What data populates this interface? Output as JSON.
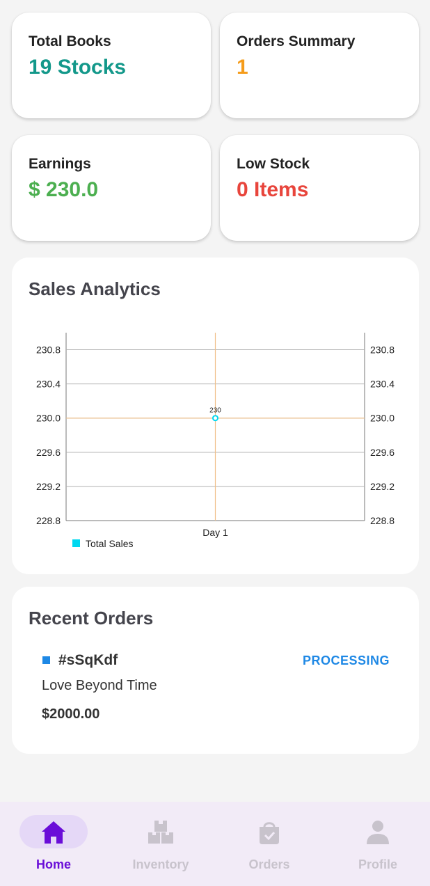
{
  "stats": [
    {
      "label": "Total Books",
      "value": "19 Stocks",
      "color": "#13988a"
    },
    {
      "label": "Orders Summary",
      "value": "1",
      "color": "#f59c1a"
    },
    {
      "label": "Earnings",
      "value": "$ 230.0",
      "color": "#4caf50"
    },
    {
      "label": "Low Stock",
      "value": "0 Items",
      "color": "#e8453c"
    }
  ],
  "analytics": {
    "title": "Sales Analytics"
  },
  "chart_data": {
    "type": "line",
    "categories": [
      "Day 1"
    ],
    "series": [
      {
        "name": "Total Sales",
        "values": [
          230
        ],
        "color": "#00d8f0"
      }
    ],
    "ylim": [
      228.8,
      231.0
    ],
    "yticks": [
      "228.8",
      "229.2",
      "229.6",
      "230.0",
      "230.4",
      "230.8"
    ],
    "data_labels": [
      "230"
    ],
    "legend_position": "bottom-left",
    "grid": true,
    "right_axis": true,
    "highlight_color": "#f0c08a"
  },
  "recent_orders": {
    "title": "Recent Orders",
    "orders": [
      {
        "id": "#sSqKdf",
        "status": "PROCESSING",
        "title": "Love Beyond Time",
        "price": "$2000.00"
      }
    ]
  },
  "nav": {
    "items": [
      {
        "label": "Home",
        "icon": "home-icon",
        "active": true
      },
      {
        "label": "Inventory",
        "icon": "inventory-icon",
        "active": false
      },
      {
        "label": "Orders",
        "icon": "orders-bag-icon",
        "active": false
      },
      {
        "label": "Profile",
        "icon": "profile-icon",
        "active": false
      }
    ],
    "active_color": "#6a0dd8",
    "inactive_color": "#c8c3cc"
  }
}
